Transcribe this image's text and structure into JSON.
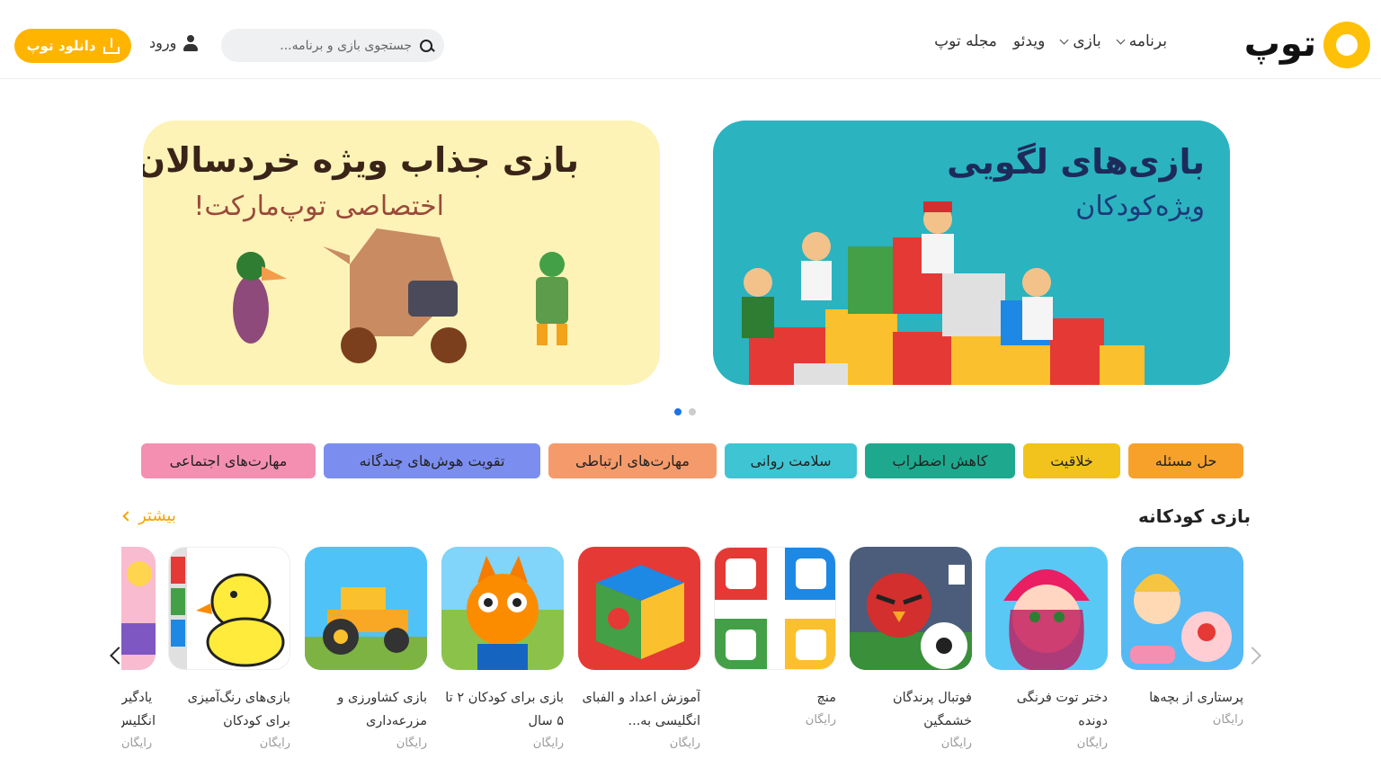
{
  "header": {
    "logo_text": "توپ",
    "nav": [
      {
        "label": "برنامه",
        "has_dropdown": true
      },
      {
        "label": "بازی",
        "has_dropdown": true
      },
      {
        "label": "ویدئو",
        "has_dropdown": false
      },
      {
        "label": "مجله توپ",
        "has_dropdown": false
      }
    ],
    "search_placeholder": "جستجوی بازی و برنامه...",
    "login_label": "ورود",
    "download_label": "دانلود توپ"
  },
  "banners": [
    {
      "title": "بازی‌های لگویی",
      "subtitle": "ویژه‌کودکان",
      "bg": "#2bb3c0"
    },
    {
      "title": "بازی جذاب ویژه خردسالان",
      "subtitle": "اختصاصی توپ‌مارکت!",
      "bg": "#fdf3b7"
    }
  ],
  "carousel": {
    "count": 2,
    "active": 0
  },
  "chips": [
    {
      "label": "حل مسئله",
      "color": "#f7a12b"
    },
    {
      "label": "خلاقیت",
      "color": "#f2c31c"
    },
    {
      "label": "کاهش اضطراب",
      "color": "#1ea88e"
    },
    {
      "label": "سلامت روانی",
      "color": "#3fc4d3"
    },
    {
      "label": "مهارت‌های ارتباطی",
      "color": "#f59a6a"
    },
    {
      "label": "تقویت هوش‌های چندگانه",
      "color": "#7b8ef0"
    },
    {
      "label": "مهارت‌های اجتماعی",
      "color": "#f48fb1"
    }
  ],
  "section": {
    "title": "بازی کودکانه",
    "more_label": "بیشتر",
    "apps": [
      {
        "name": "پرستاری از بچه‌ها",
        "price": "رایگان",
        "icon": "baby-care-icon"
      },
      {
        "name": "دختر توت فرنگی دونده",
        "price": "رایگان",
        "icon": "strawberry-girl-icon"
      },
      {
        "name": "فوتبال پرندگان خشمگین",
        "price": "رایگان",
        "icon": "angry-birds-football-icon"
      },
      {
        "name": "منچ",
        "price": "رایگان",
        "icon": "ludo-icon"
      },
      {
        "name": "آموزش اعداد و الفبای انگلیسی به...",
        "price": "رایگان",
        "icon": "alphabet-cube-icon"
      },
      {
        "name": "بازی برای کودکان ۲ تا ۵ سال",
        "price": "رایگان",
        "icon": "cat-sailor-icon"
      },
      {
        "name": "بازی کشاورزی و مزرعه‌داری",
        "price": "رایگان",
        "icon": "tractor-icon"
      },
      {
        "name": "بازی‌های رنگ‌آمیزی برای کودکان",
        "price": "رایگان",
        "icon": "duck-coloring-icon"
      },
      {
        "name": "یادگیر انگلیس",
        "price": "رایگان",
        "icon": "english-learning-icon"
      }
    ]
  }
}
